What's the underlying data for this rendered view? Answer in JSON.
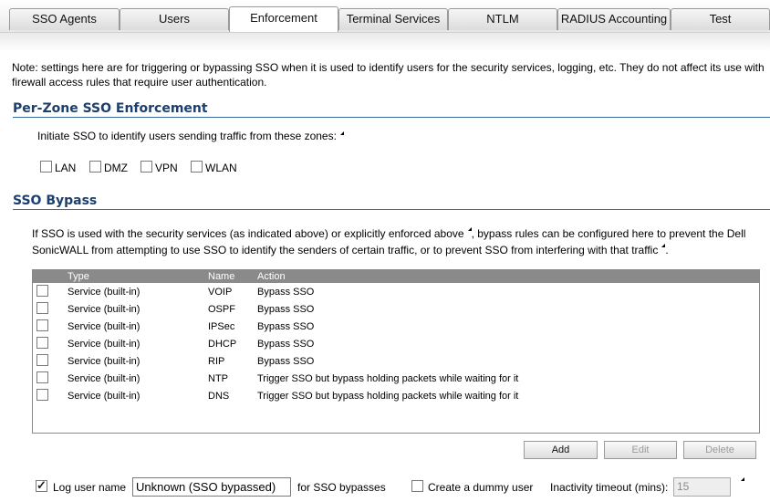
{
  "tabs": [
    {
      "label": "SSO Agents",
      "active": false
    },
    {
      "label": "Users",
      "active": false
    },
    {
      "label": "Enforcement",
      "active": true
    },
    {
      "label": "Terminal Services",
      "active": false
    },
    {
      "label": "NTLM",
      "active": false
    },
    {
      "label": "RADIUS Accounting",
      "active": false
    },
    {
      "label": "Test",
      "active": false
    }
  ],
  "note": "Note: settings here are for triggering or bypassing SSO when it is used to identify users for the security services, logging, etc. They do not affect its use with firewall access rules that require user authentication.",
  "per_zone": {
    "title": "Per-Zone SSO Enforcement",
    "instruction": "Initiate SSO to identify users sending traffic from these zones:",
    "zones": [
      {
        "label": "LAN",
        "checked": false
      },
      {
        "label": "DMZ",
        "checked": false
      },
      {
        "label": "VPN",
        "checked": false
      },
      {
        "label": "WLAN",
        "checked": false
      }
    ]
  },
  "bypass": {
    "title": "SSO Bypass",
    "description_1": "If SSO is used with the security services (as indicated above) or explicitly enforced above",
    "description_2": ", bypass rules can be configured here to prevent the Dell",
    "description_3": "SonicWALL from attempting to use SSO to identify the senders of certain traffic, or to prevent SSO from interfering with that traffic",
    "description_4": ".",
    "columns": {
      "type": "Type",
      "name": "Name",
      "action": "Action"
    },
    "rows": [
      {
        "type": "Service (built-in)",
        "name": "VOIP",
        "action": "Bypass SSO"
      },
      {
        "type": "Service (built-in)",
        "name": "OSPF",
        "action": "Bypass SSO"
      },
      {
        "type": "Service (built-in)",
        "name": "IPSec",
        "action": "Bypass SSO"
      },
      {
        "type": "Service (built-in)",
        "name": "DHCP",
        "action": "Bypass SSO"
      },
      {
        "type": "Service (built-in)",
        "name": "RIP",
        "action": "Bypass SSO"
      },
      {
        "type": "Service (built-in)",
        "name": "NTP",
        "action": "Trigger SSO but bypass holding packets while waiting for it"
      },
      {
        "type": "Service (built-in)",
        "name": "DNS",
        "action": "Trigger SSO but bypass holding packets while waiting for it"
      }
    ],
    "buttons": {
      "add": "Add",
      "edit": "Edit",
      "delete": "Delete"
    }
  },
  "footer": {
    "log_user_name_label": "Log user name",
    "log_user_name_checked": true,
    "log_user_name_value": "Unknown (SSO bypassed)",
    "for_sso_bypasses": "for SSO bypasses",
    "dummy_user_label": "Create a dummy user",
    "dummy_user_checked": false,
    "inactivity_label": "Inactivity timeout (mins):",
    "inactivity_value": "15"
  },
  "colors": {
    "section_title": "#1c3f6e",
    "table_header": "#8a8a8a"
  }
}
